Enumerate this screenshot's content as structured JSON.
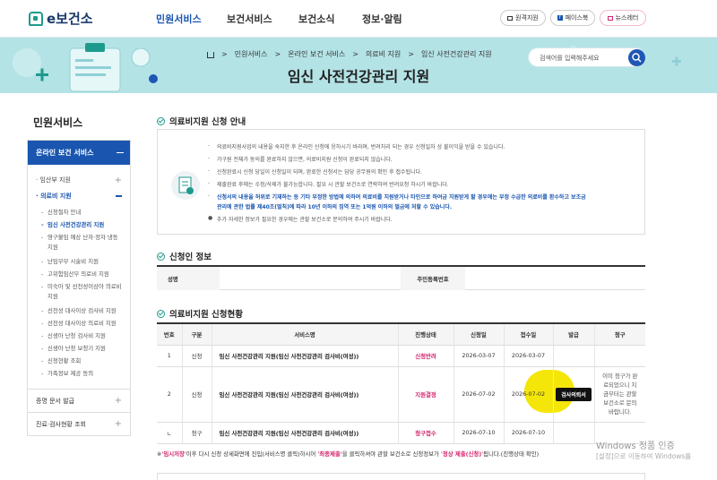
{
  "header": {
    "logo": "e보건소",
    "nav": [
      "민원서비스",
      "보건서비스",
      "보건소식",
      "정보·알림"
    ],
    "btn_remote": "원격지원",
    "btn_facebook": "페이스북",
    "btn_newsletter": "뉴스레터"
  },
  "banner": {
    "breadcrumb": [
      "온라인 보건 서비스",
      "의료비 지원",
      "임신 사전건강관리 지원"
    ],
    "breadcrumb_first": "민원서비스",
    "title": "임신 사전건강관리 지원",
    "search_placeholder": "검색어를 입력해주세요"
  },
  "lnb": {
    "title": "민원서비스",
    "active_group": "온라인 보건 서비스",
    "items": [
      {
        "label": "임산부 지원",
        "level": 1
      },
      {
        "label": "의료비 지원",
        "level": 1,
        "open": true
      },
      {
        "label": "신청절차 안내",
        "level": 2
      },
      {
        "label": "임신 사전건강관리 지원",
        "level": 2,
        "active": true
      },
      {
        "label": "영구불임 예상 난자·정자 냉동 지원",
        "level": 2
      },
      {
        "label": "난임부부 시술비 지원",
        "level": 2
      },
      {
        "label": "고위험임산부 의료비 지원",
        "level": 2
      },
      {
        "label": "미숙아 및 선천성이상아 의료비 지원",
        "level": 2
      },
      {
        "label": "선천성 대사이상 검사비 지원",
        "level": 2
      },
      {
        "label": "선천성 대사이상 의료비 지원",
        "level": 2
      },
      {
        "label": "신생아 난청 검사비 지원",
        "level": 2
      },
      {
        "label": "신생아 난청 보청기 지원",
        "level": 2
      },
      {
        "label": "신청현황 조회",
        "level": 2
      },
      {
        "label": "가족정보 제공 동의",
        "level": 2
      }
    ],
    "bottom": [
      "증명 문서 발급",
      "진료·검사현황 조회"
    ]
  },
  "notice": {
    "title": "의료비지원 신청 안내",
    "lines": [
      "의료비지원사업의 내용을 숙지한 후 온라인 신청에 응하시기 바라며, 반려처리 되는 경우 신청일자 상 불이익을 받을 수 있습니다.",
      "가구원 전체가 동의를 완료하지 않으면, 의료비지원 신청이 완료되지 않습니다.",
      "신청완료시 신청 당일이 신청일이 되며, 완료한 신청서는 담당 공무원의 확인 후 접수됩니다.",
      "제출완료 후에는 수정/삭제가 불가능합니다. 필요 시 관할 보건소로 연락하여 반려요청 하시기 바랍니다.",
      "신청서의 내용을 허위로 기재하는 등 기타 부정한 방법에 의하여 의료비를 지원받거나 타인으로 하여금 지원받게 할 경우에는 부정 수급한 의료비를 환수하고 보조금",
      "관리에 관한 법률 제40조(벌칙)에 따라 10년 이하의 징역 또는 1억원 이하의 벌금에 처할 수 있습니다.",
      "추가 자세한 정보가 필요한 경우에는 관할 보건소로 문의하여 주시기 바랍니다."
    ]
  },
  "applicant": {
    "title": "신청인 정보",
    "name_label": "성명",
    "name_value": "",
    "rrn_label": "주민등록번호",
    "rrn_value": ""
  },
  "status": {
    "title": "의료비지원 신청현황",
    "headers": [
      "번호",
      "구분",
      "서비스명",
      "진행상태",
      "신청일",
      "접수일",
      "발급",
      "청구"
    ],
    "rows": [
      {
        "no": "1",
        "type": "신청",
        "service": "임신 사전건강관리 지원(임신 사전건강관리 검사비(여성))",
        "state": "신청반려",
        "applied": "2026-03-07",
        "received": "2026-03-07",
        "issue": "",
        "claim": ""
      },
      {
        "no": "2",
        "type": "신청",
        "service": "임신 사전건강관리 지원(임신 사전건강관리 검사비(여성))",
        "state": "지원결정",
        "applied": "2026-07-02",
        "received": "2026-07-02",
        "issue": "검사의뢰서",
        "claim": "이미 청구가 완료되었으니 지금부터는 관할 보건소로 문의바랍니다."
      },
      {
        "no": "ㄴ",
        "type": "청구",
        "service": "임신 사전건강관리 지원(임신 사전건강관리 검사비(여성))",
        "state": "청구접수",
        "applied": "2026-07-10",
        "received": "2026-07-10",
        "issue": "",
        "claim": ""
      }
    ],
    "footnote_pre": "※",
    "footnote_a": "'임시저장'",
    "footnote_b": "이후 다시 신청 상세화면에 진입(서비스명 클릭)하시어 ",
    "footnote_c": "'최종제출'",
    "footnote_d": "을 클릭하셔야 관할 보건소로 신청정보가 ",
    "footnote_e": "'정상 제출(신청)'",
    "footnote_f": "됩니다.(진행상태 확인)"
  },
  "watermark": {
    "line1": "Windows 정품 인증",
    "line2": "[설정]으로 이동하여 Windows를"
  },
  "colors": {
    "primary": "#1a56b0",
    "teal": "#1e9a8c",
    "banner": "#b4e3e6",
    "status": "#d6246e",
    "highlight": "#f5e60a"
  }
}
